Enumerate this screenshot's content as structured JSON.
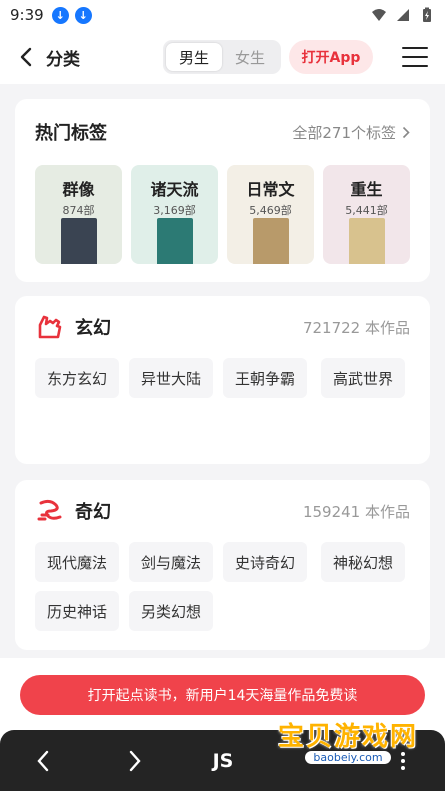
{
  "status_bar": {
    "time": "9:39"
  },
  "header": {
    "title": "分类",
    "gender_tabs": [
      "男生",
      "女生"
    ],
    "open_app_label": "打开App"
  },
  "hot_tags": {
    "title": "热门标签",
    "all_label": "全部271个标签",
    "tiles": [
      {
        "name": "群像",
        "count": "874部",
        "color": "#e6ece3",
        "cover": "#3a4452"
      },
      {
        "name": "诸天流",
        "count": "3,169部",
        "color": "#e0efe9",
        "cover": "#2c7a74"
      },
      {
        "name": "日常文",
        "count": "5,469部",
        "color": "#f3efe6",
        "cover": "#b89a6a"
      },
      {
        "name": "重生",
        "count": "5,441部",
        "color": "#f2e6ea",
        "cover": "#d8c28e"
      }
    ]
  },
  "genres": [
    {
      "name": "玄幻",
      "count": "721722 本作品",
      "tags": [
        "东方玄幻",
        "异世大陆",
        "王朝争霸",
        "高武世界"
      ]
    },
    {
      "name": "奇幻",
      "count": "159241 本作品",
      "tags": [
        "现代魔法",
        "剑与魔法",
        "史诗奇幻",
        "神秘幻想",
        "历史神话",
        "另类幻想"
      ]
    }
  ],
  "promo": {
    "text": "打开起点读书，新用户14天海量作品免费读"
  },
  "bottom_nav": {
    "js_label": "JS"
  },
  "watermark": {
    "logo_text": "宝贝游戏网",
    "domain": "baobeiy.com"
  },
  "colors": {
    "accent": "#e8323c",
    "banner": "#f0434b"
  }
}
